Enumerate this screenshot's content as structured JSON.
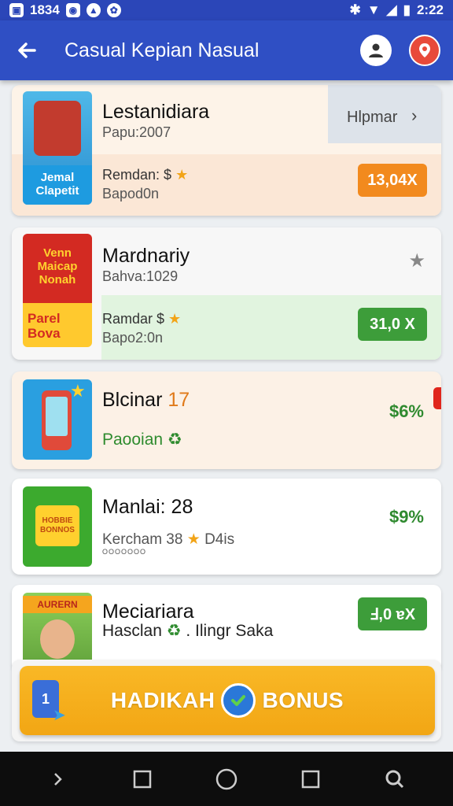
{
  "status_bar": {
    "time": "1834",
    "right_time": "2:22"
  },
  "app_bar": {
    "title": "Casual Kepian Nasual"
  },
  "cards": [
    {
      "title": "Lestanidiara",
      "subtitle": "Papu:2007",
      "line1": "Remdan: $",
      "line2": "Bapod0n",
      "tab_label": "Hlpmar",
      "price": "13,04X",
      "thumb_label": "Jemal Clapetit",
      "accent": "#f28a1e"
    },
    {
      "title": "Mardnariy",
      "subtitle": "Bahva:1029",
      "line1": "Ramdar $",
      "line2": "Bapo2:0n",
      "price": "31,0 X",
      "thumb_top": "Venn Maicap Nonah",
      "thumb_bottom": "Parel Bova",
      "accent": "#3d9d3a"
    },
    {
      "title": "Blcinar",
      "title_num": "17",
      "subtitle": "Paooian",
      "pct": "$6%"
    },
    {
      "title": "Manlai: 28",
      "subtitle": "Kercham 38",
      "extra": "D4is",
      "tiny": "OOOOOOO",
      "pct": "$9%",
      "thumb_label": "HOBBIE BONNOS"
    },
    {
      "title": "Meciariara",
      "subtitle": "Hasclan",
      "subtitle_tail": ". Ilingr Saka",
      "price": "Ⅎ,0 ɐX",
      "thumb_label": "AURERN",
      "accent": "#3d9d3a"
    }
  ],
  "bonus": {
    "label_left": "HADIKAH",
    "label_right": "BONUS",
    "badge": "1"
  }
}
